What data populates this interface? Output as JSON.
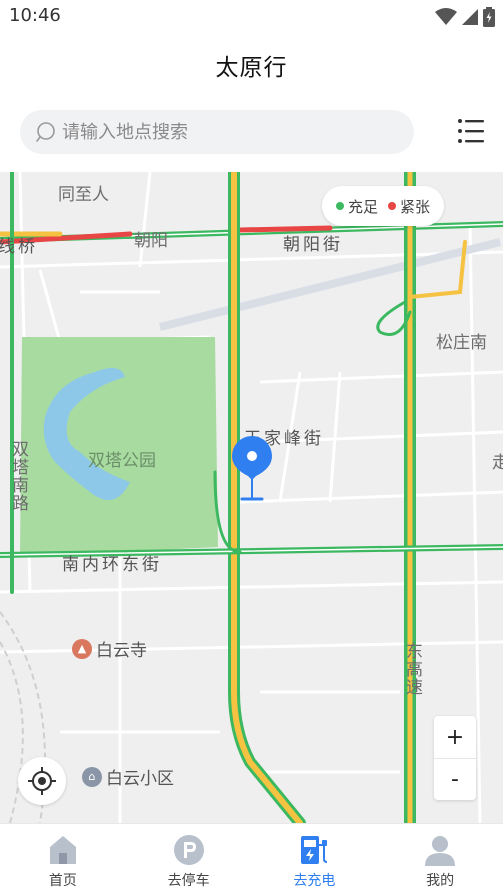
{
  "status": {
    "time": "10:46"
  },
  "app": {
    "title": "太原行"
  },
  "search": {
    "placeholder": "请输入地点搜索"
  },
  "legend": [
    {
      "label": "充足",
      "color": "#3cb960"
    },
    {
      "label": "紧张",
      "color": "#e84545"
    }
  ],
  "map": {
    "labels": {
      "tongzhiren": "同至人",
      "xianqiao": "线桥",
      "chaoyang": "朝阳",
      "chaoyang_street": "朝阳街",
      "songzhuang": "松庄南",
      "wangjiafeng_street": "王家峰街",
      "shuangta_park": "双塔公园",
      "shuangta_south_road": "双塔南路",
      "nanneihuan_east_street": "南内环东街",
      "east_expressway": "东高速",
      "edge_char": "走"
    },
    "pois": {
      "baiyun_temple": "白云寺",
      "baiyun_community": "白云小区"
    }
  },
  "zoom": {
    "plus": "+",
    "minus": "-"
  },
  "tabs": [
    {
      "label": "首页",
      "active": false,
      "icon": "home-icon"
    },
    {
      "label": "去停车",
      "active": false,
      "icon": "parking-icon"
    },
    {
      "label": "去充电",
      "active": true,
      "icon": "charging-station-icon"
    },
    {
      "label": "我的",
      "active": false,
      "icon": "user-icon"
    }
  ],
  "colors": {
    "accent": "#2f7ff0",
    "traffic_green": "#3cb960",
    "traffic_yellow": "#f5c242",
    "traffic_red": "#e84545",
    "park": "#a8dba0"
  }
}
